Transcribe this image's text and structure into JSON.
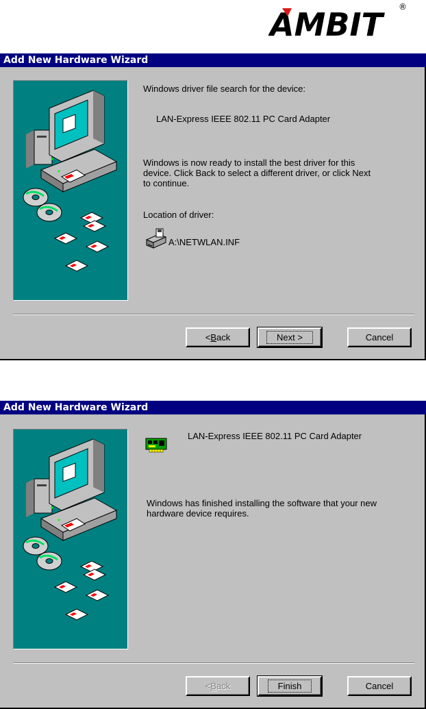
{
  "brand": {
    "logo_text": "AMBIT",
    "registered_mark": "®"
  },
  "dialogs": [
    {
      "title": "Add New Hardware Wizard",
      "search_label": "Windows driver file search for the device:",
      "device_name": "LAN-Express IEEE 802.11 PC Card Adapter",
      "ready_text_1": "Windows is now ready to install the best driver for this",
      "ready_text_2": "device. Click Back to select a different driver, or click Next",
      "ready_text_3": "to continue.",
      "location_label": "Location of driver:",
      "driver_path": "A:\\NETWLAN.INF",
      "buttons": {
        "back_pre": "< ",
        "back_key": "B",
        "back_rest": "ack",
        "next": "Next >",
        "cancel": "Cancel"
      },
      "icons": [
        "computer-illustration",
        "floppy-drive-icon"
      ]
    },
    {
      "title": "Add New Hardware Wizard",
      "device_name": "LAN-Express IEEE 802.11 PC Card Adapter",
      "finished_text_1": "Windows has finished installing the software that your new",
      "finished_text_2": "hardware device requires.",
      "buttons": {
        "back_pre": "< ",
        "back_key": "B",
        "back_rest": "ack",
        "finish": "Finish",
        "cancel": "Cancel"
      },
      "back_disabled": true,
      "icons": [
        "computer-illustration",
        "network-card-icon"
      ]
    }
  ],
  "colors": {
    "title_bar": "#000080",
    "dialog_bg": "#c0c0c0",
    "illustration_bg": "#008080",
    "logo": "#d81a1a"
  }
}
